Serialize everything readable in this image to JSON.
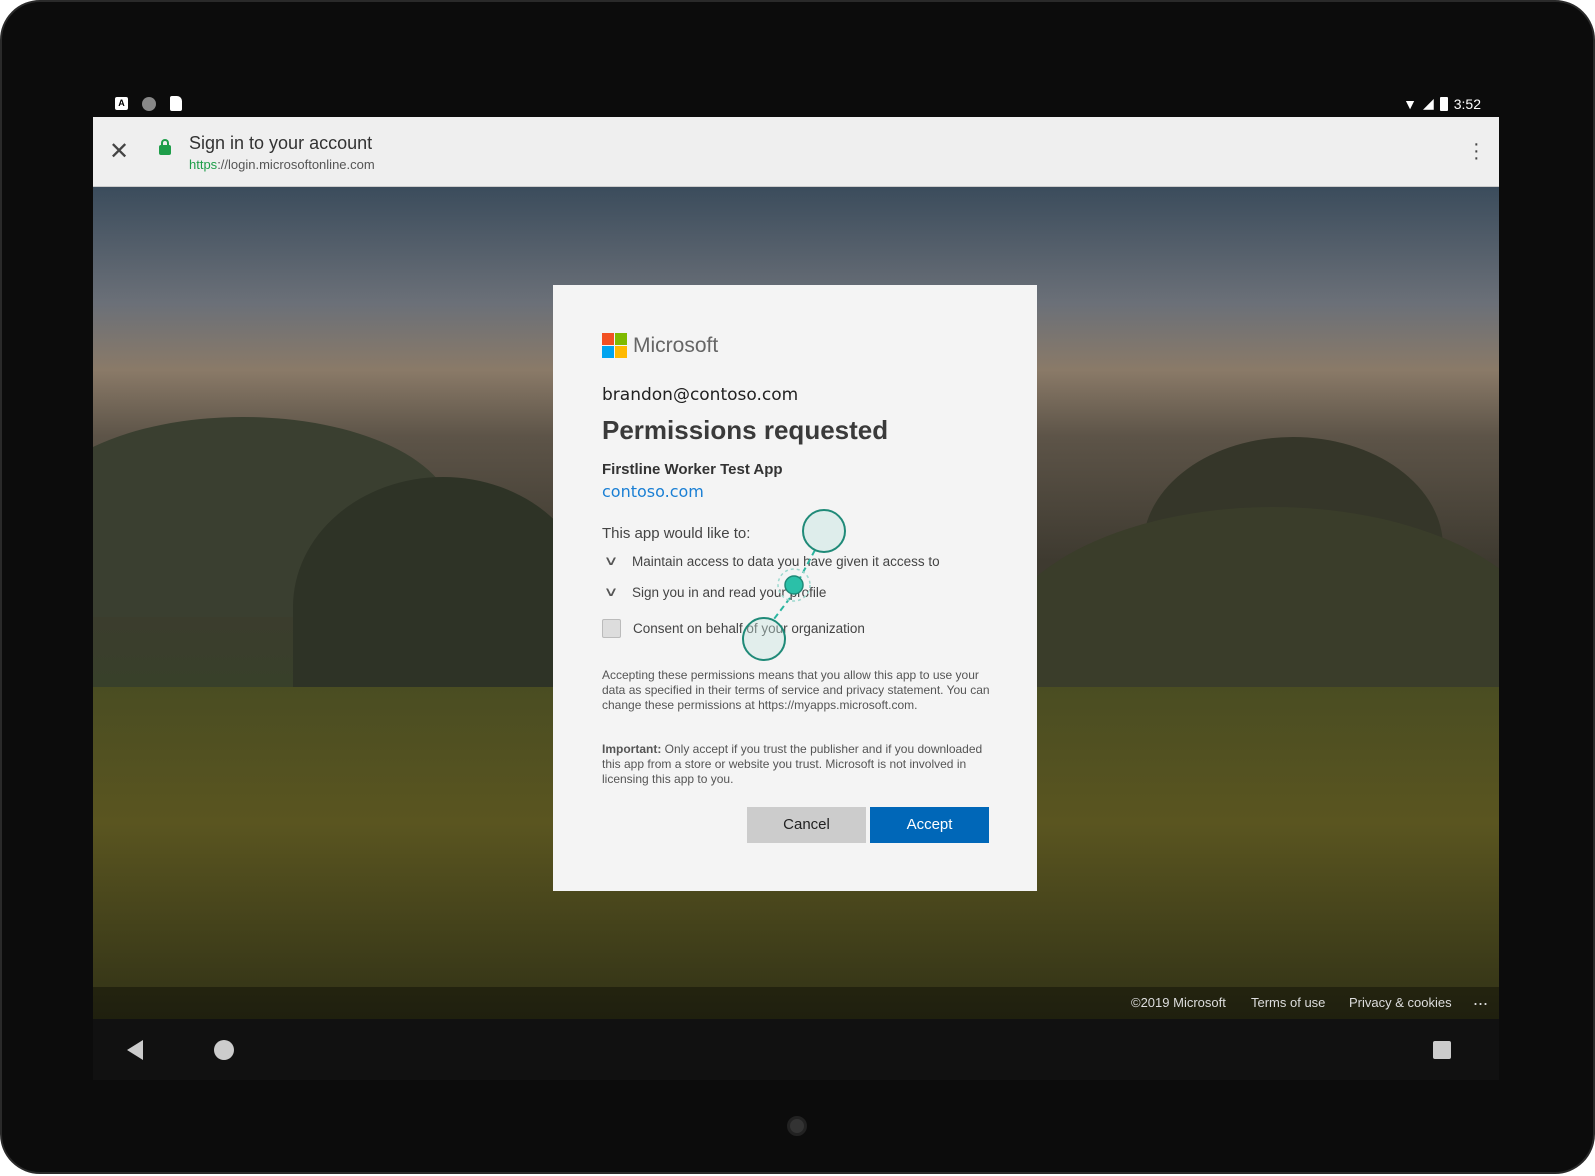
{
  "status_bar": {
    "time": "3:52",
    "icons": [
      "a-notification-icon",
      "circle-notification-icon",
      "sd-card-icon",
      "wifi-icon",
      "signal-icon",
      "battery-icon"
    ]
  },
  "browser": {
    "title": "Sign in to your account",
    "url_scheme": "https",
    "url_rest": "://login.microsoftonline.com"
  },
  "dialog": {
    "brand": "Microsoft",
    "brand_colors": [
      "#f25022",
      "#7fba00",
      "#00a4ef",
      "#ffb900"
    ],
    "email": "brandon@contoso.com",
    "title": "Permissions requested",
    "app_name": "Firstline Worker Test App",
    "publisher_link": "contoso.com",
    "intro": "This app would like to:",
    "permissions": [
      "Maintain access to data you have given it access to",
      "Sign you in and read your profile"
    ],
    "consent_label": "Consent on behalf of your organization",
    "consent_checked": false,
    "disclaimer": "Accepting these permissions means that you allow this app to use your data as specified in their terms of service and privacy statement. You can change these permissions at https://myapps.microsoft.com.",
    "important_label": "Important:",
    "important_text": " Only accept if you trust the publisher and if you downloaded this app from a store or website you trust. Microsoft is not involved in licensing this app to you.",
    "cancel": "Cancel",
    "accept": "Accept",
    "accent": "#0067b8"
  },
  "footer": {
    "copyright": "©2019 Microsoft",
    "terms": "Terms of use",
    "privacy": "Privacy & cookies",
    "more": "..."
  }
}
